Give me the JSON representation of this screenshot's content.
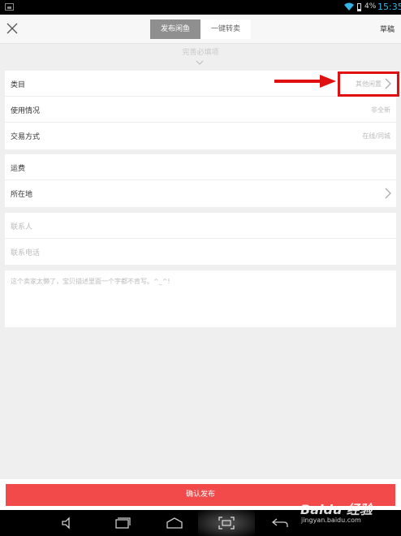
{
  "status_bar": {
    "battery_pct": "4%",
    "time": "15:35"
  },
  "header": {
    "tabs": [
      {
        "label": "发布闲鱼",
        "active": true
      },
      {
        "label": "一键转卖",
        "active": false
      }
    ],
    "draft_label": "草稿"
  },
  "hint": "完善必填项",
  "sections": {
    "basic": [
      {
        "label": "类目",
        "value": "其他闲置",
        "arrow": true
      },
      {
        "label": "使用情况",
        "value": "非全新",
        "arrow": false
      },
      {
        "label": "交易方式",
        "value": "在线/同城",
        "arrow": false
      }
    ],
    "shipping": [
      {
        "label": "运费",
        "value": "",
        "arrow": false
      },
      {
        "label": "所在地",
        "value": "",
        "arrow": true
      }
    ],
    "contact": [
      {
        "label": "联系人"
      },
      {
        "label": "联系电话"
      }
    ],
    "description_placeholder": "这个卖家太懒了，宝贝描述里面一个字都不肯写。^_^!"
  },
  "confirm_label": "确认发布",
  "watermark": {
    "text": "Baidu 经验",
    "sub": "jingyan.baidu.com"
  },
  "colors": {
    "accent": "#f24a4a",
    "annotation": "#e01010",
    "status_blue": "#35b5e5"
  },
  "icons": [
    "close-icon",
    "chevron-down-icon",
    "chevron-right-icon",
    "volume-icon",
    "recent-apps-icon",
    "home-icon",
    "screenshot-icon",
    "back-icon"
  ]
}
